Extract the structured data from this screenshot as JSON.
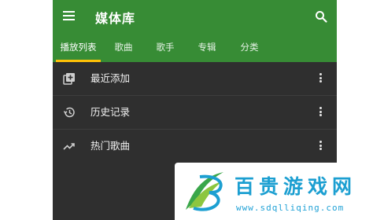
{
  "app": {
    "title": "媒体库"
  },
  "toolbar": {
    "menu_icon": "menu-icon",
    "search_icon": "search-icon"
  },
  "tabs": [
    {
      "label": "播放列表",
      "active": true
    },
    {
      "label": "歌曲",
      "active": false
    },
    {
      "label": "歌手",
      "active": false
    },
    {
      "label": "专辑",
      "active": false
    },
    {
      "label": "分类",
      "active": false
    }
  ],
  "list": [
    {
      "label": "最近添加",
      "icon": "library-add-icon"
    },
    {
      "label": "历史记录",
      "icon": "history-icon"
    },
    {
      "label": "热门歌曲",
      "icon": "trending-icon"
    }
  ],
  "watermark": {
    "title": "百贵游戏网",
    "url": "www.sdqlliqing.com"
  },
  "colors": {
    "header": "#378c35",
    "background": "#2f2f2f",
    "tab_indicator": "#ffc107",
    "watermark_text": "#1c9fd1"
  }
}
